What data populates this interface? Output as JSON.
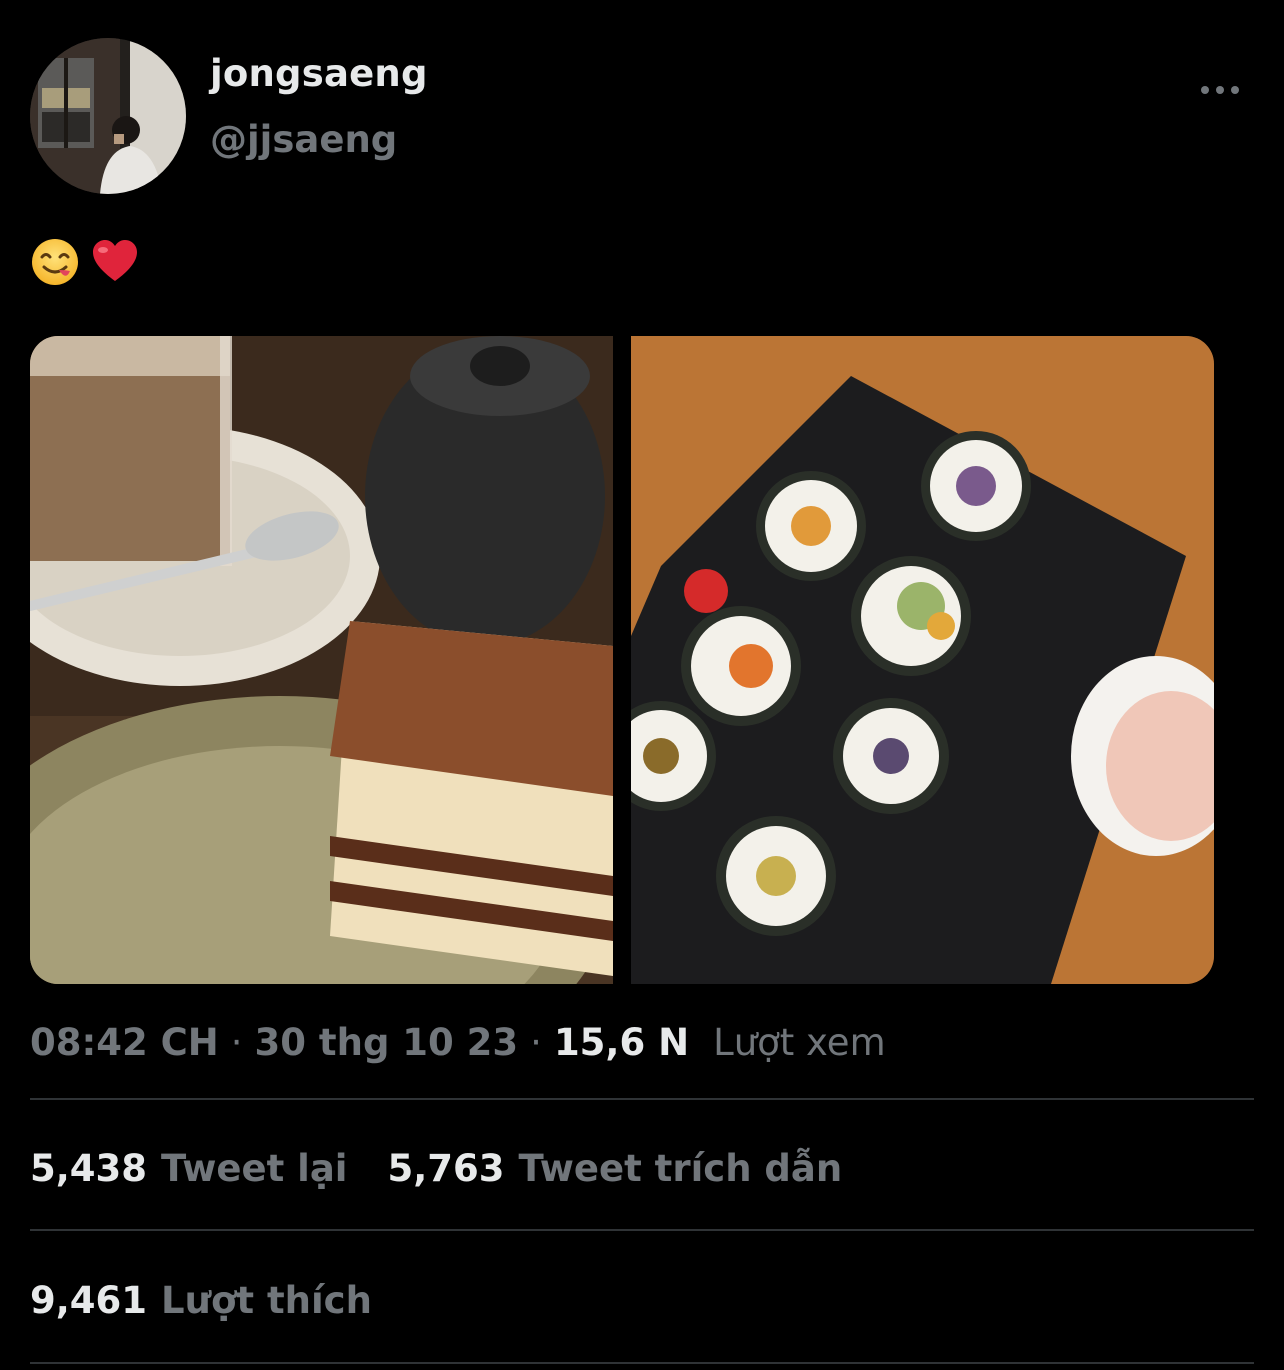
{
  "user": {
    "display_name": "jongsaeng",
    "handle": "@jjsaeng"
  },
  "tweet": {
    "emojis": [
      "smiling-face-savoring-food",
      "red-heart"
    ]
  },
  "meta": {
    "time": "08:42 CH",
    "separator": "·",
    "date": "30 thg 10 23",
    "views_count": "15,6 N",
    "views_label": "Lượt xem"
  },
  "stats": {
    "retweets_count": "5,438",
    "retweets_label": "Tweet lại",
    "quotes_count": "5,763",
    "quotes_label": "Tweet trích dẫn",
    "likes_count": "9,461",
    "likes_label": "Lượt thích"
  },
  "colors": {
    "background": "#000000",
    "text_primary": "#e7e9ea",
    "text_secondary": "#71767b",
    "divider": "#2f3336"
  }
}
